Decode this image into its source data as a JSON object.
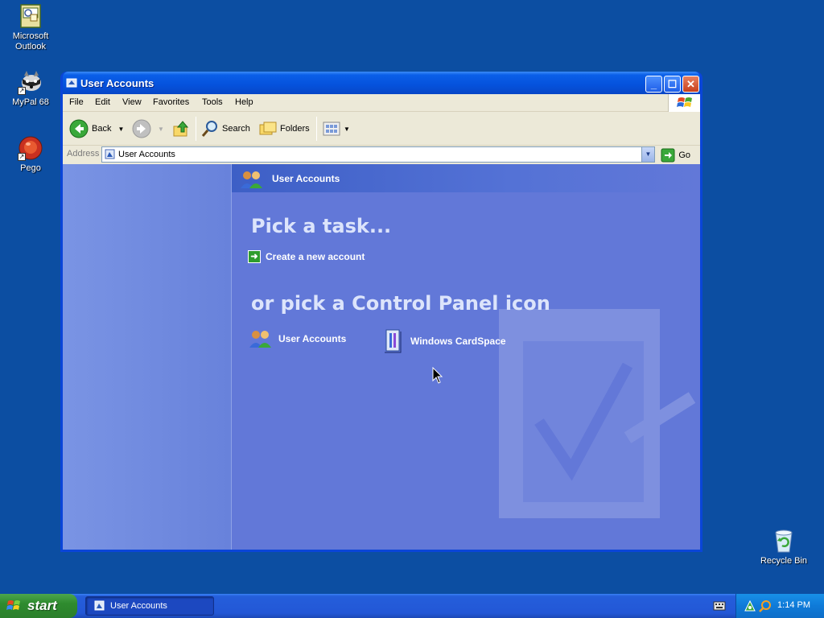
{
  "desktop": {
    "icons": [
      {
        "label": "Microsoft Outlook"
      },
      {
        "label": "MyPal 68"
      },
      {
        "label": "Pego"
      },
      {
        "label": "Recycle Bin"
      }
    ]
  },
  "window": {
    "title": "User Accounts",
    "menu": [
      "File",
      "Edit",
      "View",
      "Favorites",
      "Tools",
      "Help"
    ],
    "toolbar": {
      "back": "Back",
      "search": "Search",
      "folders": "Folders"
    },
    "address": {
      "label": "Address",
      "value": "User Accounts",
      "go": "Go"
    },
    "header": "User Accounts",
    "heading_task": "Pick a task...",
    "task_link": "Create a new account",
    "heading_icon": "or pick a Control Panel icon",
    "cp_icons": [
      {
        "label": "User Accounts"
      },
      {
        "label": "Windows CardSpace"
      }
    ]
  },
  "taskbar": {
    "start": "start",
    "task_button": "User Accounts",
    "clock": "1:14 PM"
  },
  "colors": {
    "desktop": "#0c4ea2",
    "pane": "#6278d8",
    "titlebar": "#0552dc"
  }
}
